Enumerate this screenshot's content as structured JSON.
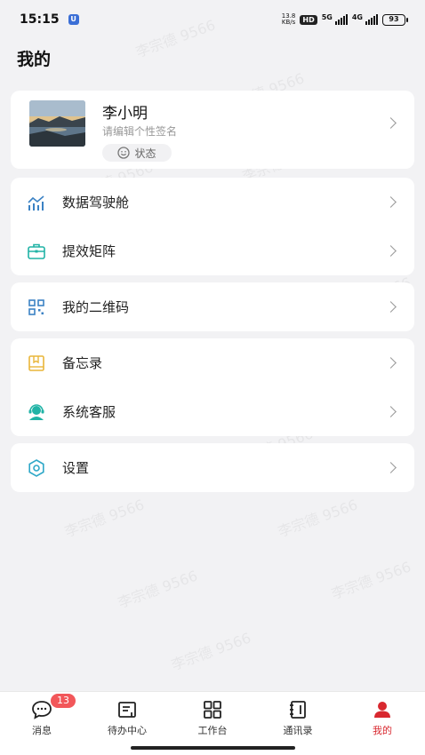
{
  "status_bar": {
    "time": "15:15",
    "network_speed": "13.8",
    "network_unit": "KB/s",
    "hd": "HD",
    "signal_1": "5G",
    "signal_2": "4G",
    "battery": "93"
  },
  "page_title": "我的",
  "profile": {
    "name": "李小明",
    "signature": "请编辑个性签名",
    "status_label": "状态"
  },
  "menu_groups": [
    [
      {
        "label": "数据驾驶舱",
        "icon": "chart-icon"
      },
      {
        "label": "提效矩阵",
        "icon": "briefcase-icon"
      }
    ],
    [
      {
        "label": "我的二维码",
        "icon": "qrcode-icon"
      }
    ],
    [
      {
        "label": "备忘录",
        "icon": "memo-icon"
      },
      {
        "label": "系统客服",
        "icon": "headset-icon"
      }
    ],
    [
      {
        "label": "设置",
        "icon": "gear-icon"
      }
    ]
  ],
  "tabbar": [
    {
      "label": "消息",
      "icon": "chat-icon",
      "badge": "13"
    },
    {
      "label": "待办中心",
      "icon": "todo-icon"
    },
    {
      "label": "工作台",
      "icon": "grid-icon"
    },
    {
      "label": "通讯录",
      "icon": "contacts-icon"
    },
    {
      "label": "我的",
      "icon": "user-icon",
      "active": true
    }
  ],
  "watermark": "李宗德 9566",
  "colors": {
    "accent": "#d8282f",
    "badge": "#f2575a",
    "icon_blue": "#3b82c4",
    "icon_teal": "#21b3a6",
    "icon_yellow": "#e9b63a"
  }
}
